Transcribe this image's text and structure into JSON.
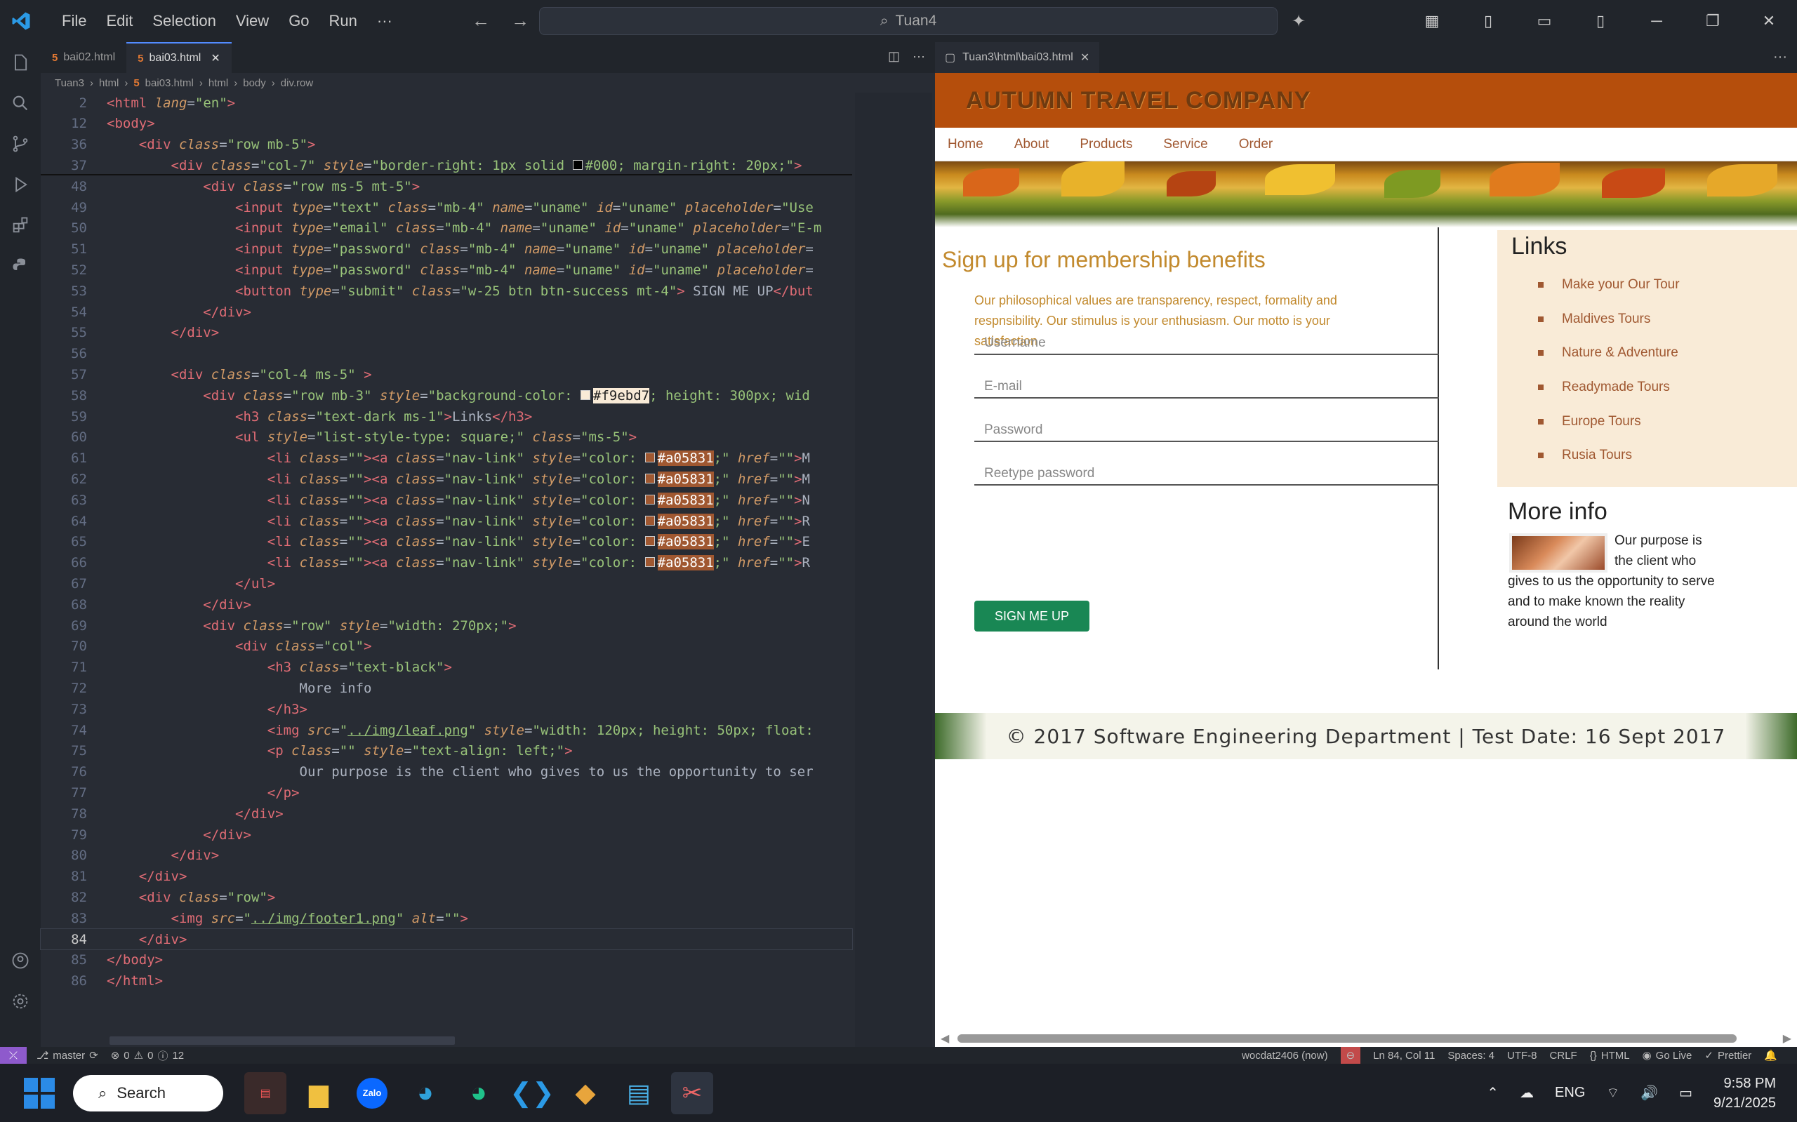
{
  "menu": [
    "File",
    "Edit",
    "Selection",
    "View",
    "Go",
    "Run",
    "···"
  ],
  "command_center": "Tuan4",
  "tabs": [
    {
      "label": "bai02.html"
    },
    {
      "label": "bai03.html"
    }
  ],
  "breadcrumb": [
    "Tuan3",
    "html",
    "bai03.html",
    "html",
    "body",
    "div.row"
  ],
  "code_lines": [
    {
      "n": "2",
      "html": "<span class='t'>&lt;html</span> <span class='a'>lang</span><span class='p'>=</span><span class='s'>\"en\"</span><span class='t'>&gt;</span>"
    },
    {
      "n": "12",
      "html": "<span class='t'>&lt;body&gt;</span>"
    },
    {
      "n": "36",
      "html": "    <span class='t'>&lt;div</span> <span class='a'>class</span>=<span class='s'>\"row mb-5\"</span><span class='t'>&gt;</span>"
    },
    {
      "n": "37",
      "html": "        <span class='t'>&lt;div</span> <span class='a'>class</span>=<span class='s'>\"col-7\"</span> <span class='a'>style</span>=<span class='s'>\"border-right: 1px solid </span><span class='sw' style='background:#000'></span><span class='s'>#000; margin-right: 20px;\"</span><span class='t'>&gt;</span>"
    },
    {
      "n": "48",
      "html": "            <span class='t'>&lt;div</span> <span class='a'>class</span>=<span class='s'>\"row ms-5 mt-5\"</span><span class='t'>&gt;</span>"
    },
    {
      "n": "49",
      "html": "                <span class='t'>&lt;input</span> <span class='a'>type</span>=<span class='s'>\"text\"</span> <span class='a'>class</span>=<span class='s'>\"mb-4\"</span> <span class='a'>name</span>=<span class='s'>\"uname\"</span> <span class='a'>id</span>=<span class='s'>\"uname\"</span> <span class='a'>placeholder</span>=<span class='s'>\"Use</span>"
    },
    {
      "n": "50",
      "html": "                <span class='t'>&lt;input</span> <span class='a'>type</span>=<span class='s'>\"email\"</span> <span class='a'>class</span>=<span class='s'>\"mb-4\"</span> <span class='a'>name</span>=<span class='s'>\"uname\"</span> <span class='a'>id</span>=<span class='s'>\"uname\"</span> <span class='a'>placeholder</span>=<span class='s'>\"E-m</span>"
    },
    {
      "n": "51",
      "html": "                <span class='t'>&lt;input</span> <span class='a'>type</span>=<span class='s'>\"password\"</span> <span class='a'>class</span>=<span class='s'>\"mb-4\"</span> <span class='a'>name</span>=<span class='s'>\"uname\"</span> <span class='a'>id</span>=<span class='s'>\"uname\"</span> <span class='a'>placeholder</span>="
    },
    {
      "n": "52",
      "html": "                <span class='t'>&lt;input</span> <span class='a'>type</span>=<span class='s'>\"password\"</span> <span class='a'>class</span>=<span class='s'>\"mb-4\"</span> <span class='a'>name</span>=<span class='s'>\"uname\"</span> <span class='a'>id</span>=<span class='s'>\"uname\"</span> <span class='a'>placeholder</span>="
    },
    {
      "n": "53",
      "html": "                <span class='t'>&lt;button</span> <span class='a'>type</span>=<span class='s'>\"submit\"</span> <span class='a'>class</span>=<span class='s'>\"w-25 btn btn-success mt-4\"</span><span class='t'>&gt;</span> SIGN ME UP<span class='t'>&lt;/but</span>"
    },
    {
      "n": "54",
      "html": "            <span class='t'>&lt;/div&gt;</span>"
    },
    {
      "n": "55",
      "html": "        <span class='t'>&lt;/div&gt;</span>"
    },
    {
      "n": "56",
      "html": ""
    },
    {
      "n": "57",
      "html": "        <span class='t'>&lt;div</span> <span class='a'>class</span>=<span class='s'>\"col-4 ms-5\"</span> <span class='t'>&gt;</span>"
    },
    {
      "n": "58",
      "html": "            <span class='t'>&lt;div</span> <span class='a'>class</span>=<span class='s'>\"row mb-3\"</span> <span class='a'>style</span>=<span class='s'>\"background-color: </span><span class='sw' style='background:#f9ebd7'></span><span class='s' style='background:#f9ebd7;color:#222'>#f9ebd7</span><span class='s'>; height: 300px; wid</span>"
    },
    {
      "n": "59",
      "html": "                <span class='t'>&lt;h3</span> <span class='a'>class</span>=<span class='s'>\"text-dark ms-1\"</span><span class='t'>&gt;</span>Links<span class='t'>&lt;/h3&gt;</span>"
    },
    {
      "n": "60",
      "html": "                <span class='t'>&lt;ul</span> <span class='a'>style</span>=<span class='s'>\"list-style-type: square;\"</span> <span class='a'>class</span>=<span class='s'>\"ms-5\"</span><span class='t'>&gt;</span>"
    },
    {
      "n": "61",
      "html": "                    <span class='t'>&lt;li</span> <span class='a'>class</span>=<span class='s'>\"\"</span><span class='t'>&gt;&lt;a</span> <span class='a'>class</span>=<span class='s'>\"nav-link\"</span> <span class='a'>style</span>=<span class='s'>\"color: </span><span class='sw' style='background:#a05831'></span><span class='s' style='background:#a05831;color:#fff'>#a05831</span><span class='s'>;\"</span> <span class='a'>href</span>=<span class='s'>\"\"</span><span class='t'>&gt;</span>M"
    },
    {
      "n": "62",
      "html": "                    <span class='t'>&lt;li</span> <span class='a'>class</span>=<span class='s'>\"\"</span><span class='t'>&gt;&lt;a</span> <span class='a'>class</span>=<span class='s'>\"nav-link\"</span> <span class='a'>style</span>=<span class='s'>\"color: </span><span class='sw' style='background:#a05831'></span><span class='s' style='background:#a05831;color:#fff'>#a05831</span><span class='s'>;\"</span> <span class='a'>href</span>=<span class='s'>\"\"</span><span class='t'>&gt;</span>M"
    },
    {
      "n": "63",
      "html": "                    <span class='t'>&lt;li</span> <span class='a'>class</span>=<span class='s'>\"\"</span><span class='t'>&gt;&lt;a</span> <span class='a'>class</span>=<span class='s'>\"nav-link\"</span> <span class='a'>style</span>=<span class='s'>\"color: </span><span class='sw' style='background:#a05831'></span><span class='s' style='background:#a05831;color:#fff'>#a05831</span><span class='s'>;\"</span> <span class='a'>href</span>=<span class='s'>\"\"</span><span class='t'>&gt;</span>N"
    },
    {
      "n": "64",
      "html": "                    <span class='t'>&lt;li</span> <span class='a'>class</span>=<span class='s'>\"\"</span><span class='t'>&gt;&lt;a</span> <span class='a'>class</span>=<span class='s'>\"nav-link\"</span> <span class='a'>style</span>=<span class='s'>\"color: </span><span class='sw' style='background:#a05831'></span><span class='s' style='background:#a05831;color:#fff'>#a05831</span><span class='s'>;\"</span> <span class='a'>href</span>=<span class='s'>\"\"</span><span class='t'>&gt;</span>R"
    },
    {
      "n": "65",
      "html": "                    <span class='t'>&lt;li</span> <span class='a'>class</span>=<span class='s'>\"\"</span><span class='t'>&gt;&lt;a</span> <span class='a'>class</span>=<span class='s'>\"nav-link\"</span> <span class='a'>style</span>=<span class='s'>\"color: </span><span class='sw' style='background:#a05831'></span><span class='s' style='background:#a05831;color:#fff'>#a05831</span><span class='s'>;\"</span> <span class='a'>href</span>=<span class='s'>\"\"</span><span class='t'>&gt;</span>E"
    },
    {
      "n": "66",
      "html": "                    <span class='t'>&lt;li</span> <span class='a'>class</span>=<span class='s'>\"\"</span><span class='t'>&gt;&lt;a</span> <span class='a'>class</span>=<span class='s'>\"nav-link\"</span> <span class='a'>style</span>=<span class='s'>\"color: </span><span class='sw' style='background:#a05831'></span><span class='s' style='background:#a05831;color:#fff'>#a05831</span><span class='s'>;\"</span> <span class='a'>href</span>=<span class='s'>\"\"</span><span class='t'>&gt;</span>R"
    },
    {
      "n": "67",
      "html": "                <span class='t'>&lt;/ul&gt;</span>"
    },
    {
      "n": "68",
      "html": "            <span class='t'>&lt;/div&gt;</span>"
    },
    {
      "n": "69",
      "html": "            <span class='t'>&lt;div</span> <span class='a'>class</span>=<span class='s'>\"row\"</span> <span class='a'>style</span>=<span class='s'>\"width: 270px;\"</span><span class='t'>&gt;</span>"
    },
    {
      "n": "70",
      "html": "                <span class='t'>&lt;div</span> <span class='a'>class</span>=<span class='s'>\"col\"</span><span class='t'>&gt;</span>"
    },
    {
      "n": "71",
      "html": "                    <span class='t'>&lt;h3</span> <span class='a'>class</span>=<span class='s'>\"text-black\"</span><span class='t'>&gt;</span>"
    },
    {
      "n": "72",
      "html": "                        More info"
    },
    {
      "n": "73",
      "html": "                    <span class='t'>&lt;/h3&gt;</span>"
    },
    {
      "n": "74",
      "html": "                    <span class='t'>&lt;img</span> <span class='a'>src</span>=<span class='s'>\"<u>../img/leaf.png</u>\"</span> <span class='a'>style</span>=<span class='s'>\"width: 120px; height: 50px; float:</span>"
    },
    {
      "n": "75",
      "html": "                    <span class='t'>&lt;p</span> <span class='a'>class</span>=<span class='s'>\"\"</span> <span class='a'>style</span>=<span class='s'>\"text-align: left;\"</span><span class='t'>&gt;</span>"
    },
    {
      "n": "76",
      "html": "                        Our purpose is the client who gives to us the opportunity to ser"
    },
    {
      "n": "77",
      "html": "                    <span class='t'>&lt;/p&gt;</span>"
    },
    {
      "n": "78",
      "html": "                <span class='t'>&lt;/div&gt;</span>"
    },
    {
      "n": "79",
      "html": "            <span class='t'>&lt;/div&gt;</span>"
    },
    {
      "n": "80",
      "html": "        <span class='t'>&lt;/div&gt;</span>"
    },
    {
      "n": "81",
      "html": "    <span class='t'>&lt;/div&gt;</span>"
    },
    {
      "n": "82",
      "html": "    <span class='t'>&lt;div</span> <span class='a'>class</span>=<span class='s'>\"row\"</span><span class='t'>&gt;</span>"
    },
    {
      "n": "83",
      "html": "        <span class='t'>&lt;img</span> <span class='a'>src</span>=<span class='s'>\"<u>../img/footer1.png</u>\"</span> <span class='a'>alt</span>=<span class='s'>\"\"</span><span class='t'>&gt;</span>"
    },
    {
      "n": "84",
      "html": "    <span class='t'>&lt;/div&gt;</span>"
    },
    {
      "n": "85",
      "html": "<span class='t'>&lt;/body&gt;</span>"
    },
    {
      "n": "86",
      "html": "<span class='t'>&lt;/html&gt;</span>"
    }
  ],
  "preview": {
    "tab_label": "Tuan3\\html\\bai03.html",
    "company": "AUTUMN TRAVEL COMPANY",
    "nav": [
      "Home",
      "About",
      "Products",
      "Service",
      "Order"
    ],
    "signup_heading": "Sign up for membership benefits",
    "signup_text": "Our philosophical values are transparency, respect, formality and respnsibility. Our stimulus is your enthusiasm. Our motto is your satisfaction",
    "fields": [
      "Username",
      "E-mail",
      "Password",
      "Reetype password"
    ],
    "button": "SIGN ME UP",
    "links_heading": "Links",
    "links": [
      "Make your Our Tour",
      "Maldives Tours",
      "Nature & Adventure",
      "Readymade Tours",
      "Europe Tours",
      "Rusia Tours"
    ],
    "more_heading": "More info",
    "more_text": "Our purpose is the client who gives to us the opportunity to serve and to make known the reality around the world",
    "footer": "© 2017 Software Engineering Department | Test Date: 16 Sept 2017"
  },
  "status": {
    "branch": "master",
    "problems": "0",
    "warnings": "0",
    "info": "12",
    "user": "wocdat2406 (now)",
    "position": "Ln 84, Col 11",
    "spaces": "Spaces: 4",
    "encoding": "UTF-8",
    "eol": "CRLF",
    "language": "HTML",
    "golive": "Go Live",
    "prettier": "Prettier"
  },
  "taskbar": {
    "search": "Search",
    "lang": "ENG",
    "time": "9:58 PM",
    "date": "9/21/2025"
  }
}
